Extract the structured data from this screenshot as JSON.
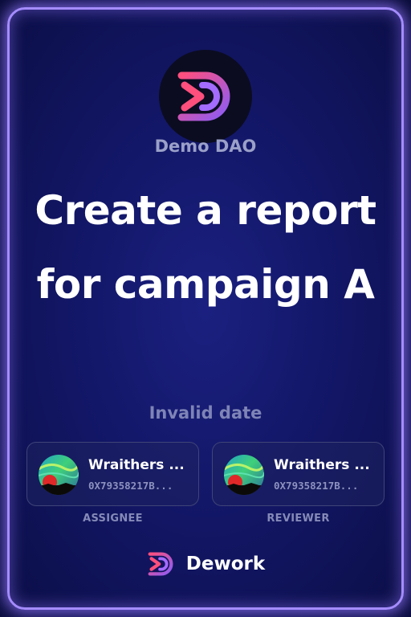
{
  "org": {
    "name": "Demo DAO",
    "logo_icon": "dework-logo-icon"
  },
  "task": {
    "title": "Create a report for campaign A",
    "date": "Invalid date"
  },
  "people": {
    "assignee": {
      "name": "Wraithers ...",
      "address": "0X79358217B...",
      "role_label": "ASSIGNEE",
      "avatar_icon": "aurora-avatar"
    },
    "reviewer": {
      "name": "Wraithers ...",
      "address": "0X79358217B...",
      "role_label": "REVIEWER",
      "avatar_icon": "aurora-avatar"
    }
  },
  "footer": {
    "brand": "Dework",
    "brand_icon": "dework-logo-icon"
  },
  "colors": {
    "accent_pink": "#e8457f",
    "accent_purple": "#8b5cf6",
    "border_glow": "#a48cff",
    "background": "#131768"
  }
}
